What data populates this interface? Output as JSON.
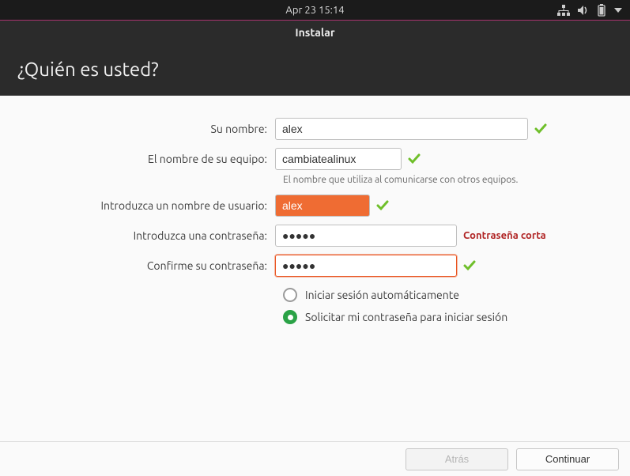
{
  "topbar": {
    "datetime": "Apr 23  15:14"
  },
  "titlebar": {
    "title": "Instalar"
  },
  "header": {
    "title": "¿Quién es usted?"
  },
  "labels": {
    "name": "Su nombre:",
    "hostname": "El nombre de su equipo:",
    "hostname_help": "El nombre que utiliza al comunicarse con otros equipos.",
    "username": "Introduzca un nombre de usuario:",
    "password": "Introduzca una contraseña:",
    "confirm": "Confirme su contraseña:"
  },
  "values": {
    "name": "alex",
    "hostname": "cambiatealinux",
    "username": "alex",
    "password": "●●●●●",
    "confirm": "●●●●●"
  },
  "password_warning": "Contraseña corta",
  "login_options": {
    "auto": "Iniciar sesión automáticamente",
    "require": "Solicitar mi contraseña para iniciar sesión"
  },
  "buttons": {
    "back": "Atrás",
    "continue": "Continuar"
  }
}
